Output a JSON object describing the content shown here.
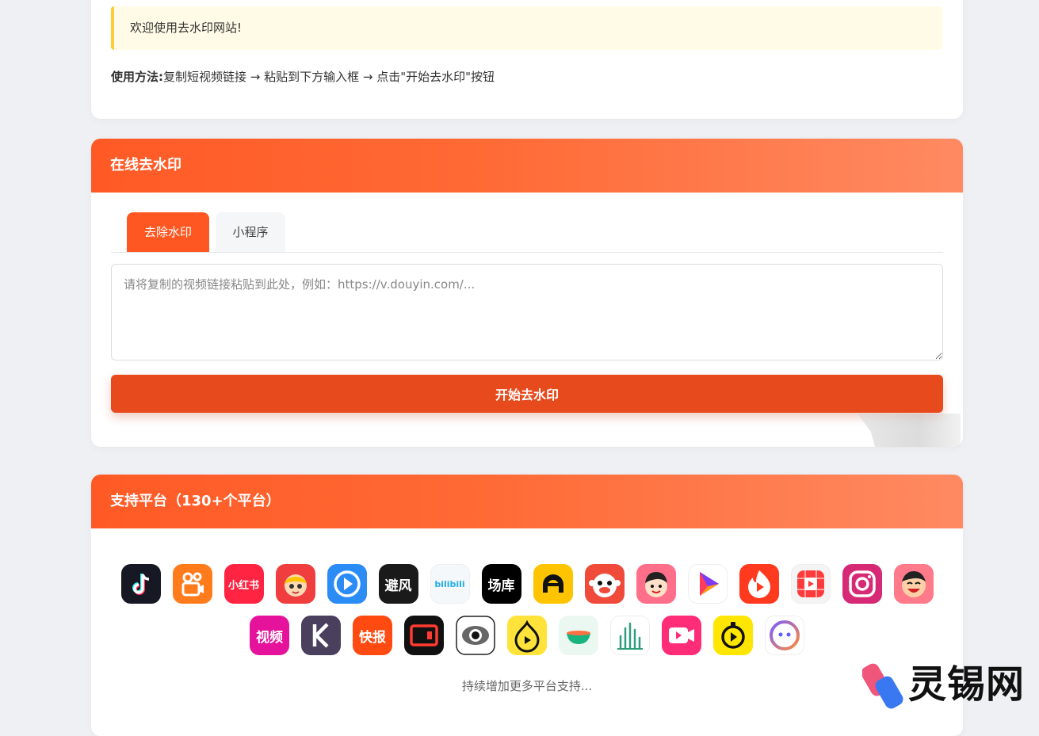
{
  "notice": {
    "text": "欢迎使用去水印网站!"
  },
  "usage": {
    "label": "使用方法:",
    "text": "复制短视频链接 → 粘贴到下方输入框 → 点击\"开始去水印\"按钮"
  },
  "tool": {
    "title": "在线去水印",
    "tabs": [
      {
        "label": "去除水印",
        "active": true
      },
      {
        "label": "小程序",
        "active": false
      }
    ],
    "input": {
      "value": "",
      "placeholder": "请将复制的视频链接粘贴到此处，例如：https://v.douyin.com/..."
    },
    "submit_label": "开始去水印"
  },
  "platforms": {
    "title": "支持平台（130+个平台）",
    "icon_rows": [
      [
        {
          "name": "douyin-icon",
          "bg": "#161823",
          "text": ""
        },
        {
          "name": "kuaishou-icon",
          "bg": "#ff7b1c",
          "text": ""
        },
        {
          "name": "xiaohongshu-icon",
          "bg": "#ff2442",
          "text": "小红书"
        },
        {
          "name": "manga-girl-icon",
          "bg": "#f03e3e",
          "text": ""
        },
        {
          "name": "blue-play-icon",
          "bg": "#2b8cf6",
          "text": ""
        },
        {
          "name": "bifeng-icon",
          "bg": "#1a1a1a",
          "text": "避风"
        },
        {
          "name": "bilibili-icon",
          "bg": "#f4f8fb",
          "text": "bilibili"
        },
        {
          "name": "changku-icon",
          "bg": "#000000",
          "text": "场库"
        },
        {
          "name": "yellow-arch-icon",
          "bg": "#ffc400",
          "text": ""
        },
        {
          "name": "monkey-icon",
          "bg": "#f04a3a",
          "text": ""
        },
        {
          "name": "cartoon-face-icon",
          "bg": "#ff6f8a",
          "text": ""
        },
        {
          "name": "triangle-play-icon",
          "bg": "#ffffff",
          "text": ""
        },
        {
          "name": "flame-play-icon",
          "bg": "#ff3a1f",
          "text": ""
        },
        {
          "name": "grid-play-icon",
          "bg": "#f4f4f4",
          "text": ""
        },
        {
          "name": "instagram-icon",
          "bg": "#d62976",
          "text": ""
        },
        {
          "name": "laughing-face-icon",
          "bg": "#ff7a8a",
          "text": ""
        }
      ],
      [
        {
          "name": "shipin-icon",
          "bg": "#e5139b",
          "text": "视频"
        },
        {
          "name": "k-letter-icon",
          "bg": "#4a3f5c",
          "text": ""
        },
        {
          "name": "kuaibao-icon",
          "bg": "#ff4a12",
          "text": "快报"
        },
        {
          "name": "red-frame-icon",
          "bg": "#111111",
          "text": ""
        },
        {
          "name": "eye-icon",
          "bg": "#ffffff",
          "text": ""
        },
        {
          "name": "pear-play-icon",
          "bg": "#ffe33b",
          "text": ""
        },
        {
          "name": "green-bowl-icon",
          "bg": "#eaf8f1",
          "text": ""
        },
        {
          "name": "bamboo-icon",
          "bg": "#ffffff",
          "text": ""
        },
        {
          "name": "camera-play-icon",
          "bg": "#ff2c78",
          "text": ""
        },
        {
          "name": "stopwatch-icon",
          "bg": "#ffe600",
          "text": ""
        },
        {
          "name": "chat-bubble-icon",
          "bg": "#ffffff",
          "text": ""
        }
      ]
    ],
    "more_text": "持续增加更多平台支持..."
  },
  "watermark": {
    "text": "灵锡网"
  }
}
